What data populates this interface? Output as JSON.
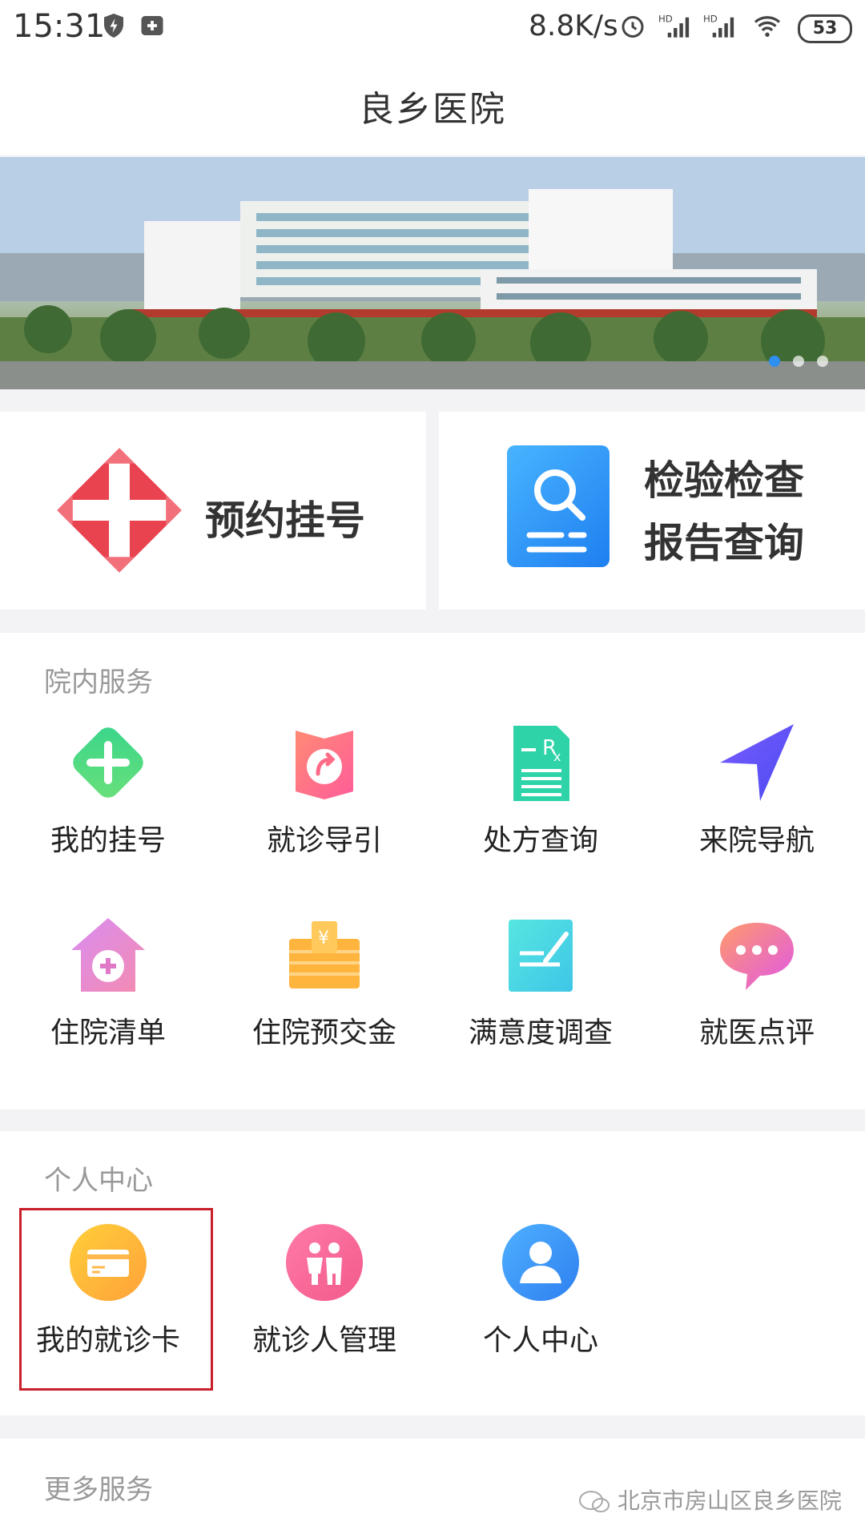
{
  "status": {
    "time": "15:31",
    "speed": "8.8K/s",
    "battery": "53"
  },
  "header": {
    "title": "良乡医院"
  },
  "quick": [
    {
      "label": "预约挂号"
    },
    {
      "line1": "检验检查",
      "line2": "报告查询"
    }
  ],
  "inhouse": {
    "title": "院内服务",
    "items": [
      {
        "label": "我的挂号",
        "icon": "green-plus-icon"
      },
      {
        "label": "就诊导引",
        "icon": "guide-icon"
      },
      {
        "label": "处方查询",
        "icon": "prescription-icon"
      },
      {
        "label": "来院导航",
        "icon": "navigation-arrow-icon"
      },
      {
        "label": "住院清单",
        "icon": "house-plus-icon"
      },
      {
        "label": "住院预交金",
        "icon": "money-stack-icon"
      },
      {
        "label": "满意度调查",
        "icon": "survey-icon"
      },
      {
        "label": "就医点评",
        "icon": "chat-bubble-icon"
      }
    ]
  },
  "personal": {
    "title": "个人中心",
    "items": [
      {
        "label": "我的就诊卡",
        "icon": "card-icon"
      },
      {
        "label": "就诊人管理",
        "icon": "people-icon"
      },
      {
        "label": "个人中心",
        "icon": "user-icon"
      }
    ]
  },
  "more": {
    "title": "更多服务",
    "watermark": "北京市房山区良乡医院"
  },
  "colors": {
    "accent_red": "#e8434f",
    "accent_blue": "#2f8ff0",
    "highlight_border": "#c8202b"
  }
}
